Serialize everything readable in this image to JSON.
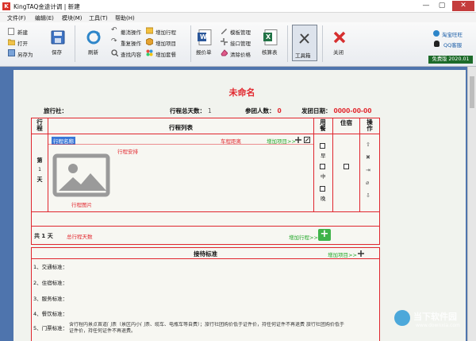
{
  "window": {
    "app_icon_text": "K",
    "title": "KingTAQ金途计调 | 新建",
    "minimize": "—",
    "maximize": "▢",
    "close": "✕"
  },
  "menu": [
    "文件(F)",
    "编辑(E)",
    "模块(M)",
    "工具(T)",
    "帮助(H)"
  ],
  "toolbar": {
    "new": "新建",
    "open": "打开",
    "save_as": "另存为",
    "save": "保存",
    "refresh": "刷新",
    "undo": "撤消操作",
    "redo": "重复操作",
    "find": "查找内容",
    "add_row": "增加行程",
    "add_item": "增加项目",
    "add_meal": "增加套餐",
    "quote": "报价单",
    "template_mgr": "模板管理",
    "api_mgr": "接口管理",
    "clear_price": "清除价格",
    "check_sheet": "核算表",
    "toolbox": "工具箱",
    "close": "关闭",
    "taobao": "淘宝旺旺",
    "qq": "QQ客服",
    "edition": "免费版",
    "version": "2020.01",
    "word_letter": "W",
    "excel_letter": "X"
  },
  "document": {
    "title": "未命名",
    "agency_label": "旅行社：",
    "total_days_label": "行程总天数：",
    "total_days": "1",
    "participants_label": "参团人数：",
    "participants": "0",
    "depart_label": "发团日期：",
    "depart_date": "0000-00-00"
  },
  "table": {
    "col_trip": [
      "行",
      "程"
    ],
    "col_list": "行程列表",
    "col_meal": [
      "用",
      "餐"
    ],
    "col_stay": "住宿",
    "col_ops": [
      "操",
      "作"
    ],
    "day_label": [
      "第",
      "1",
      "天"
    ],
    "trip_name": "行程名称",
    "vehicle_distance": "车程距离",
    "add_item_link": "增加项目>>",
    "itinerary_arrangement": "行程安排",
    "itinerary_image": "行程图片",
    "meals": [
      "早",
      "中",
      "晚"
    ],
    "total_label": "共 1 天",
    "total_days_hint": "总行程天数",
    "add_row_link": "增加行程>>"
  },
  "reception": {
    "title": "接待标准",
    "add_item_link": "增加项目>>",
    "items": [
      "1、交通标准：",
      "2、住宿标准：",
      "3、服务标准：",
      "4、餐饮标准：",
      "5、门票标准："
    ],
    "ticket_note_1": "含行程内景点首道门票（景区内小门票、缆车、电瓶车等自费）；旅行社团购价低于证件价，持任何证件不再退费 旅行社团购价低于",
    "ticket_note_2": "证件价，持任何证件不再退费。"
  },
  "watermark": {
    "site": "当下软件园",
    "url": "www.downxia.com"
  }
}
